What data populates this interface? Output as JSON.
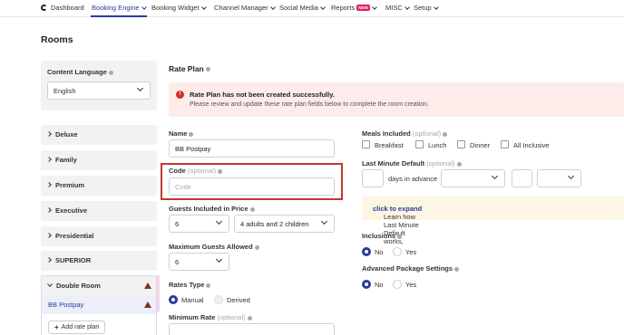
{
  "nav": {
    "items": [
      {
        "label": "Dashboard"
      },
      {
        "label": "Booking Engine"
      },
      {
        "label": "Booking Widget"
      },
      {
        "label": "Channel Manager"
      },
      {
        "label": "Social Media"
      },
      {
        "label": "Reports"
      },
      {
        "label": "MISC"
      },
      {
        "label": "Setup"
      }
    ],
    "new_badge": "NEW"
  },
  "page_title": "Rooms",
  "content_language": {
    "label": "Content Language",
    "value": "English"
  },
  "rooms": [
    {
      "label": "Deluxe"
    },
    {
      "label": "Family"
    },
    {
      "label": "Premium"
    },
    {
      "label": "Executive"
    },
    {
      "label": "Presidential"
    },
    {
      "label": "SUPERIOR"
    },
    {
      "label": "Double Room"
    }
  ],
  "rate_plan_item": "BB Postpay",
  "add_rate_plan": "Add rate plan",
  "rate_plan": {
    "title": "Rate Plan",
    "alert_title": "Rate Plan has not been created successfully.",
    "alert_body": "Please review and update these rate plan fields below to complete the room creation.",
    "name_label": "Name",
    "name_value": "BB Postpay",
    "code_label": "Code",
    "code_optional": "(optional)",
    "code_placeholder": "Code",
    "guests_label": "Guests Included in Price",
    "guests_value": "6",
    "guests_combo": "4 adults and 2 children",
    "max_guests_label": "Maximum Guests Allowed",
    "max_guests_value": "6",
    "rates_type_label": "Rates Type",
    "rates_manual": "Manual",
    "rates_derived": "Derived",
    "min_rate_label": "Minimum Rate",
    "min_rate_optional": "(optional)"
  },
  "meals": {
    "label": "Meals Included",
    "optional": "(optional)",
    "options": [
      "Breakfast",
      "Lunch",
      "Dinner",
      "All Inclusive"
    ]
  },
  "last_minute": {
    "label": "Last Minute Default",
    "optional": "(optional)",
    "days_text": "days in advance",
    "learn_text": "Learn how Last Minute Default works,",
    "learn_link": "click to expand"
  },
  "inclusions": {
    "label": "Inclusions",
    "no": "No",
    "yes": "Yes"
  },
  "advanced": {
    "label": "Advanced Package Settings",
    "no": "No",
    "yes": "Yes"
  },
  "colors": {
    "accent": "#2a3a9c",
    "error": "#d32f2f",
    "alert_bg": "#fdecea",
    "warn_bg": "#fdf6e3"
  }
}
